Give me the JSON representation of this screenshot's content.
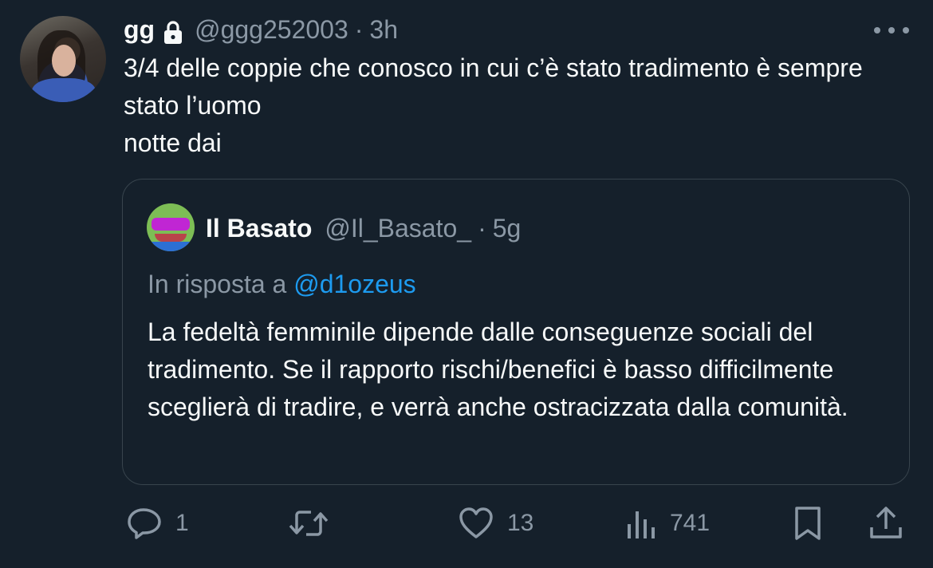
{
  "tweet": {
    "author_name": "gg",
    "handle": "@ggg252003",
    "separator": "·",
    "time": "3h",
    "text": "3/4 delle coppie che conosco in cui c’è stato tradimento è sempre stato l’uomo\nnotte dai"
  },
  "quoted": {
    "author_name": "Il Basato",
    "handle": "@Il_Basato_",
    "separator": "·",
    "time": "5g",
    "reply_prefix": "In risposta a",
    "reply_mention": "@d1ozeus",
    "text": "La fedeltà femminile dipende dalle conseguenze sociali del tradimento. Se il rapporto rischi/benefici è basso difficilmente sceglierà di tradire, e verrà anche ostracizzata dalla comunità."
  },
  "actions": {
    "replies": "1",
    "likes": "13",
    "views": "741"
  },
  "icons": {
    "lock": "lock-icon",
    "more": "more-icon",
    "reply": "reply-icon",
    "retweet": "retweet-icon",
    "like": "heart-icon",
    "views": "views-icon",
    "bookmark": "bookmark-icon",
    "share": "share-icon"
  },
  "colors": {
    "background": "#15202b",
    "text": "#f7f9f9",
    "secondary": "#8b98a5",
    "link": "#1d9bf0",
    "border": "#38444d"
  }
}
